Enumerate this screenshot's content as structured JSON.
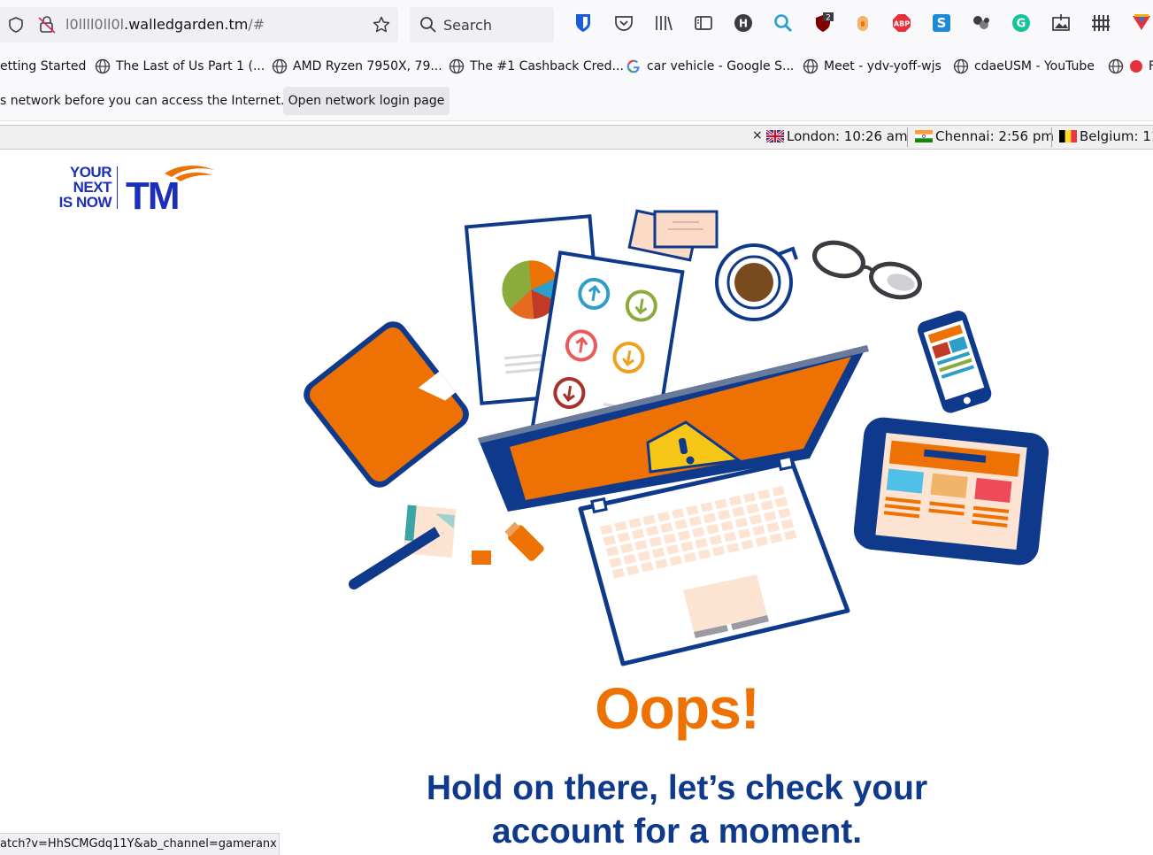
{
  "toolbar": {
    "url_host_prefix": "l0llll0ll0l",
    "url_host_suffix": ".walledgarden.tm",
    "url_path": "/#",
    "search_placeholder": "Search",
    "ublock_badge": "2"
  },
  "bookmarks": [
    {
      "label": "etting Started"
    },
    {
      "label": "The Last of Us Part 1 (..."
    },
    {
      "label": "AMD Ryzen 7950X, 79..."
    },
    {
      "label": "The #1 Cashback Cred..."
    },
    {
      "label": "car vehicle - Google S..."
    },
    {
      "label": "Meet - ydv-yoff-wjs"
    },
    {
      "label": "cdaeUSM - YouTube"
    },
    {
      "label": "F"
    }
  ],
  "notification": {
    "text": "s network before you can access the Internet.",
    "button_label": "Open network login page"
  },
  "clocks": {
    "close": "×",
    "items": [
      {
        "label": "London: 10:26 am"
      },
      {
        "label": "Chennai: 2:56 pm"
      },
      {
        "label": "Belgium: 11"
      }
    ]
  },
  "page": {
    "logo_line1": "YOUR",
    "logo_line2": "NEXT",
    "logo_line3": "IS NOW",
    "logo_brand": "TM",
    "heading": "Oops!",
    "subheading_line1": "Hold on there, let’s check your",
    "subheading_line2": "account for a moment."
  },
  "status_url": "atch?v=HhSCMGdq11Y&ab_channel=gameranx",
  "colors": {
    "accent_orange": "#ee7203",
    "navy": "#0f3a8c",
    "brand_blue": "#1c2fb8"
  }
}
